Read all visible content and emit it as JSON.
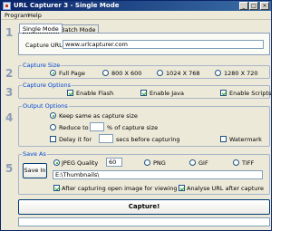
{
  "window": {
    "title": "URL Capturer 3 - Single Mode"
  },
  "menu": {
    "program": "Program",
    "help": "Help"
  },
  "section_numbers": {
    "s1": "1",
    "s2": "2",
    "s3": "3",
    "s4": "4",
    "s5": "5"
  },
  "mode_tabs": {
    "single": "Single Mode",
    "batch": "Batch Mode"
  },
  "url": {
    "label": "Capture URL:",
    "value": "www.urlcapturer.com"
  },
  "capture_size": {
    "title": "Capture Size",
    "options": [
      "Full Page",
      "800 X 600",
      "1024 X 768",
      "1280 X 720"
    ],
    "selected": "Full Page"
  },
  "capture_options": {
    "title": "Capture Options",
    "flash": "Enable Flash",
    "java": "Enable Java",
    "scripts": "Enable Scripts",
    "flash_checked": true,
    "java_checked": true,
    "scripts_checked": true
  },
  "output_options": {
    "title": "Output Options",
    "keep_same": "Keep same as capture size",
    "reduce_to": "Reduce to",
    "reduce_suffix": "% of capture size",
    "reduce_value": "",
    "delay_label": "Delay it for",
    "delay_suffix": "secs before capturing",
    "delay_value": "",
    "watermark": "Watermark"
  },
  "save_as": {
    "title": "Save As",
    "save_in": "Save In",
    "jpeg_quality": "JPEG Quality",
    "jpeg_value": "60",
    "png": "PNG",
    "gif": "GIF",
    "tiff": "TIFF",
    "path": "E:\\Thumbnails\\",
    "open_after": "After capturing open image for viewing",
    "analyse_after": "Analyse URL after capture"
  },
  "capture_button": "Capture!",
  "status_text": ""
}
